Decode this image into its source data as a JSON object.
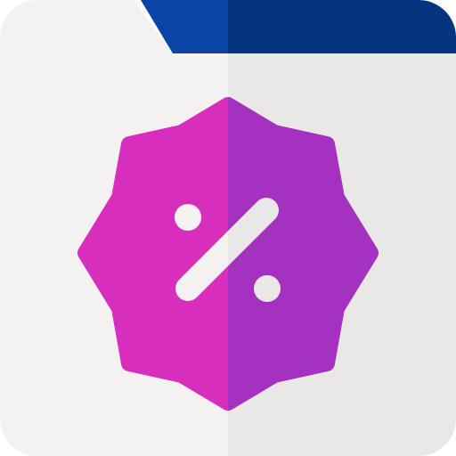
{
  "icon": {
    "name": "discount-folder-icon",
    "colors": {
      "folder_left": "#F3F2F1",
      "folder_right": "#E9E8E6",
      "tab_left": "#0A44A4",
      "tab_right": "#04347E",
      "badge_left": "#D82EBE",
      "badge_right": "#A431C0",
      "symbol_left": "#F3F2F1",
      "symbol_right": "#E9E8E6"
    }
  }
}
